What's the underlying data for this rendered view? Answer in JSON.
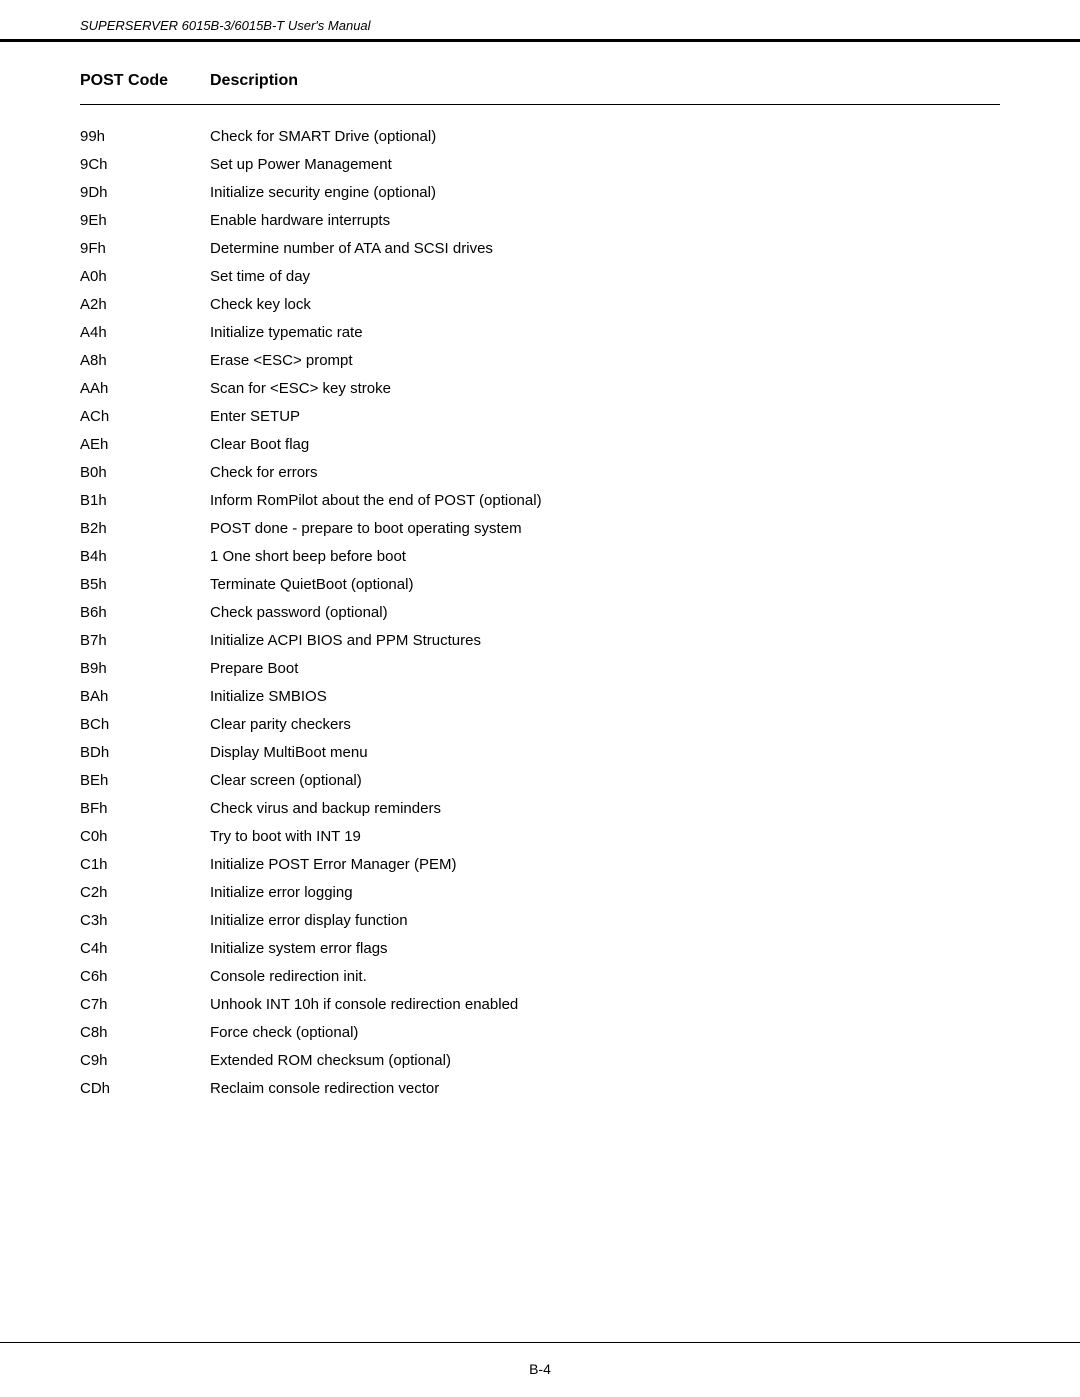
{
  "header": {
    "title": "SUPERSERVER 6015B-3/6015B-T User's Manual"
  },
  "table": {
    "col_code_label": "POST Code",
    "col_desc_label": "Description",
    "rows": [
      {
        "code": "99h",
        "desc": "Check for SMART Drive (optional)"
      },
      {
        "code": "9Ch",
        "desc": "Set up Power Management"
      },
      {
        "code": "9Dh",
        "desc": "Initialize security engine (optional)"
      },
      {
        "code": "9Eh",
        "desc": "Enable hardware interrupts"
      },
      {
        "code": "9Fh",
        "desc": "Determine number of ATA and SCSI drives"
      },
      {
        "code": "A0h",
        "desc": "Set time of day"
      },
      {
        "code": "A2h",
        "desc": "Check key lock"
      },
      {
        "code": "A4h",
        "desc": "Initialize typematic rate"
      },
      {
        "code": "A8h",
        "desc": "Erase <ESC> prompt"
      },
      {
        "code": "AAh",
        "desc": "Scan for <ESC> key stroke"
      },
      {
        "code": "ACh",
        "desc": "Enter SETUP"
      },
      {
        "code": "AEh",
        "desc": "Clear Boot flag"
      },
      {
        "code": "B0h",
        "desc": "Check for errors"
      },
      {
        "code": "B1h",
        "desc": "Inform RomPilot about the end of POST (optional)"
      },
      {
        "code": "B2h",
        "desc": "POST done - prepare to boot operating system"
      },
      {
        "code": "B4h",
        "desc": "1 One short beep before boot"
      },
      {
        "code": "B5h",
        "desc": "Terminate QuietBoot (optional)"
      },
      {
        "code": "B6h",
        "desc": "Check password (optional)"
      },
      {
        "code": "B7h",
        "desc": "Initialize ACPI BIOS and PPM Structures"
      },
      {
        "code": "B9h",
        "desc": "Prepare Boot"
      },
      {
        "code": "BAh",
        "desc": "Initialize SMBIOS"
      },
      {
        "code": "BCh",
        "desc": "Clear parity checkers"
      },
      {
        "code": "BDh",
        "desc": "Display MultiBoot menu"
      },
      {
        "code": "BEh",
        "desc": "Clear screen (optional)"
      },
      {
        "code": "BFh",
        "desc": "Check virus and backup reminders"
      },
      {
        "code": "C0h",
        "desc": "Try to boot with INT 19"
      },
      {
        "code": "C1h",
        "desc": "Initialize POST Error Manager (PEM)"
      },
      {
        "code": "C2h",
        "desc": "Initialize error logging"
      },
      {
        "code": "C3h",
        "desc": "Initialize error display function"
      },
      {
        "code": "C4h",
        "desc": "Initialize system error flags"
      },
      {
        "code": "C6h",
        "desc": "Console redirection init."
      },
      {
        "code": "C7h",
        "desc": "Unhook INT 10h if console redirection enabled"
      },
      {
        "code": "C8h",
        "desc": "Force check (optional)"
      },
      {
        "code": "C9h",
        "desc": "Extended ROM checksum (optional)"
      },
      {
        "code": "CDh",
        "desc": "Reclaim console redirection vector"
      }
    ]
  },
  "footer": {
    "page": "B-4"
  }
}
